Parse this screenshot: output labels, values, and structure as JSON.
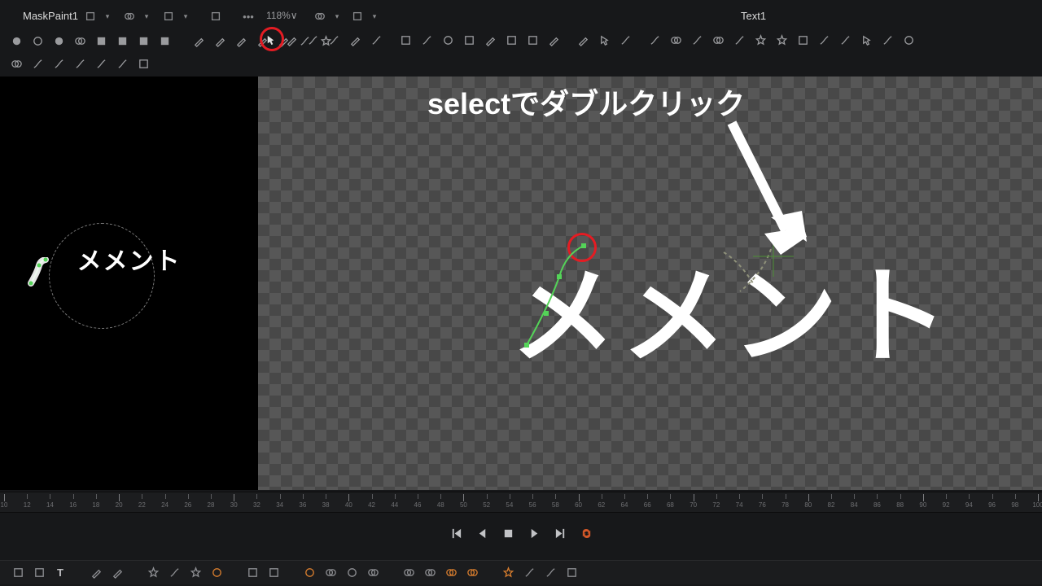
{
  "tabs": {
    "left_label": "MaskPaint1",
    "right_label": "Text1",
    "zoom": "118%∨"
  },
  "viewer": {
    "left_text": "メメント",
    "right_text": "メメント"
  },
  "annotation": {
    "text": "selectでダブルクリック"
  },
  "ruler": {
    "start": 10,
    "end": 100,
    "step": 2
  },
  "playback": [
    "first",
    "prev",
    "stop",
    "play",
    "last",
    "loop"
  ],
  "colors": {
    "accent_red": "#e41c23",
    "accent_orange": "#d97e2e",
    "loop_orange": "#d25728"
  },
  "tab_icons_left": [
    "window",
    "chevron",
    "layers",
    "chevron",
    "grid",
    "chevron",
    "rect",
    "more"
  ],
  "tab_icons_right": [
    "split",
    "chevron",
    "window",
    "chevron"
  ],
  "toolbar_row1_left": [
    "dot",
    "circle",
    "dot-open",
    "metaball",
    "square",
    "rect-up",
    "rect",
    "rect-dash",
    "pen",
    "brush",
    "wand",
    "eraser",
    "pencil",
    "curve",
    "fx"
  ],
  "toolbar_row1_right_start": [
    "select-arrow",
    "pencil",
    "slash",
    "slash2",
    "brush",
    "curve",
    "square",
    "scribble",
    "circle",
    "rect2",
    "eraser",
    "crop",
    "crop2",
    "pen2",
    "pencil2",
    "arrow-cursor",
    "curve-a",
    "curve-b",
    "redo",
    "curve-c",
    "undo",
    "big-curve",
    "star",
    "star",
    "x-boxed",
    "cross-curve",
    "s-curve",
    "chevron-r",
    "s-curve2",
    "target"
  ],
  "toolbar_row2": [
    "corner",
    "slash",
    "boomerang",
    "interp",
    "scribble",
    "flow",
    "x-box"
  ],
  "shelf_icons": [
    "bg",
    "rect-tool",
    "text",
    "brush",
    "paint",
    "sparkle",
    "swirl",
    "star",
    "glow",
    "square",
    "underlay",
    "lens",
    "3d",
    "target",
    "blur",
    "shade",
    "camera",
    "color",
    "lut",
    "fx",
    "wipe",
    "wipe2",
    "mask"
  ]
}
